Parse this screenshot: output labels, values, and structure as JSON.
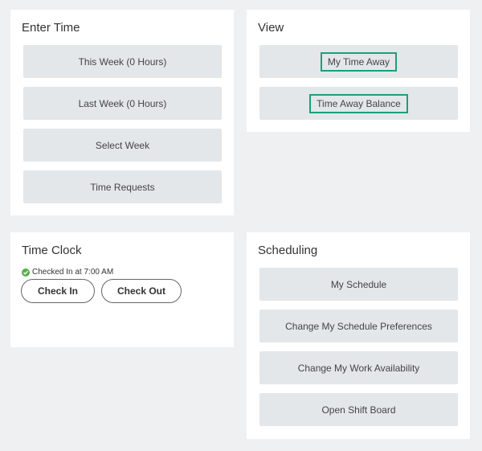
{
  "enter_time": {
    "title": "Enter Time",
    "buttons": [
      "This Week (0 Hours)",
      "Last Week (0 Hours)",
      "Select Week",
      "Time Requests"
    ]
  },
  "view": {
    "title": "View",
    "buttons": [
      "My Time Away",
      "Time Away Balance"
    ]
  },
  "time_clock": {
    "title": "Time Clock",
    "status": "Checked In at 7:00 AM",
    "check_in": "Check In",
    "check_out": "Check Out"
  },
  "scheduling": {
    "title": "Scheduling",
    "buttons": [
      "My Schedule",
      "Change My Schedule Preferences",
      "Change My Work Availability",
      "Open Shift Board"
    ]
  },
  "colors": {
    "highlight": "#1aa07a",
    "button_bg": "#e3e7ea",
    "status_check": "#56b04a"
  }
}
